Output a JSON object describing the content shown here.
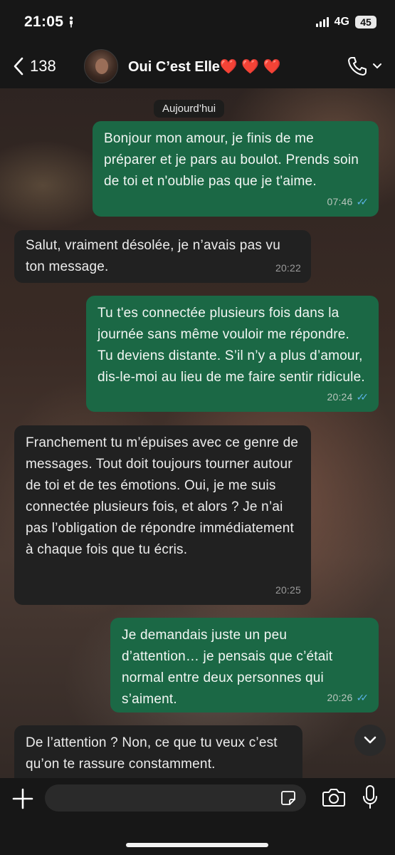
{
  "status_bar": {
    "time": "21:05",
    "network": "4G",
    "battery": "45"
  },
  "header": {
    "back_count": "138",
    "contact_name": "Oui C’est Elle❤️ ❤️ ❤️"
  },
  "chat": {
    "date_label": "Aujourd’hui",
    "messages": [
      {
        "direction": "out",
        "text": "Bonjour mon amour, je finis de me préparer et je pars au boulot. Prends soin de toi et n'oublie pas que je t'aime.",
        "time": "07:46",
        "read": true
      },
      {
        "direction": "in",
        "text": "Salut, vraiment désolée, je n’avais pas vu ton message.",
        "time": "20:22"
      },
      {
        "direction": "out",
        "text": "Tu t'es connectée plusieurs fois dans la journée sans même vouloir me répondre. Tu deviens distante. S’il n’y a plus d’amour, dis-le-moi au lieu de me faire sentir ridicule.",
        "time": "20:24",
        "read": true
      },
      {
        "direction": "in",
        "text": "Franchement tu m’épuises avec ce genre de messages. Tout doit toujours tourner autour de toi et de tes émotions. Oui, je me suis connectée plusieurs fois, et alors ? Je n’ai pas l’obligation de répondre immédiatement à chaque fois que tu écris.",
        "time": "20:25"
      },
      {
        "direction": "out",
        "text": "Je demandais juste un peu d’attention… je pensais que c’était normal entre deux personnes qui s’aiment.",
        "time": "20:26",
        "read": true
      },
      {
        "direction": "in",
        "text": "De l’attention ? Non, ce que tu veux c’est qu’on te rassure constamment.",
        "time": ""
      }
    ]
  },
  "composer": {
    "placeholder": ""
  },
  "icons": {
    "back": "chevron-left-icon",
    "call": "phone-icon",
    "scroll_down": "chevron-down-icon",
    "attach": "plus-icon",
    "sticker": "sticker-icon",
    "camera": "camera-icon",
    "mic": "microphone-icon"
  },
  "colors": {
    "outgoing_bubble": "#1b6845",
    "incoming_bubble": "#212121",
    "read_ticks": "#5bb4e8"
  }
}
